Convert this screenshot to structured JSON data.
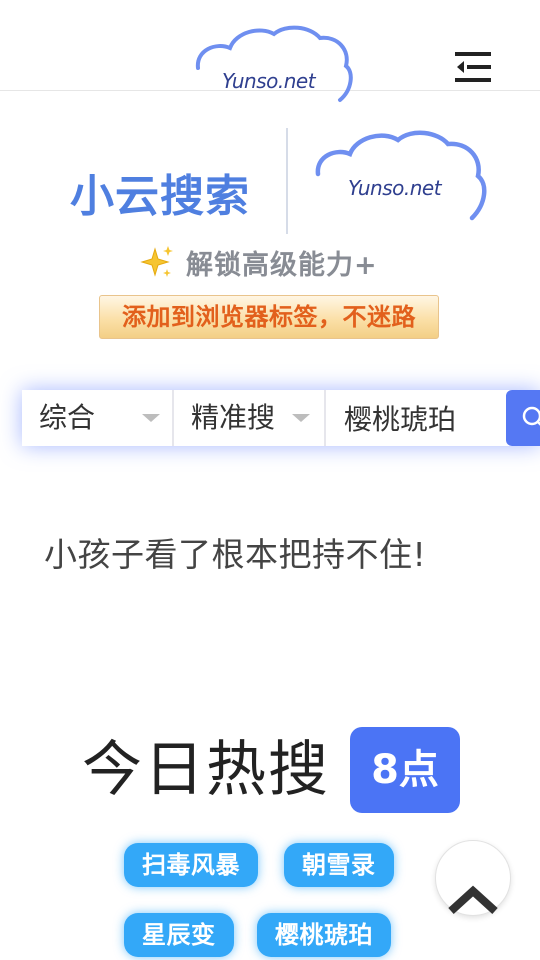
{
  "header": {
    "logo_text": "Yunso.net",
    "menu_icon": "menu-collapse-icon"
  },
  "brand": {
    "name": "小云搜索",
    "logo_text": "Yunso.net",
    "unlock_text": "解锁高级能力+",
    "unlock_icon": "sparkle-icon",
    "bookmark_text": "添加到浏览器标签，不迷路"
  },
  "search": {
    "category": "综合",
    "mode": "精准搜",
    "query": "樱桃琥珀",
    "button_icon": "search-icon"
  },
  "headline": "小孩子看了根本把持不住!",
  "hot": {
    "title": "今日热搜",
    "time": "8点",
    "tags": [
      "扫毒风暴",
      "朝雪录",
      "星辰变",
      "樱桃琥珀"
    ]
  },
  "back_to_top_icon": "chevron-up-icon",
  "colors": {
    "brand_blue": "#4f7fe0",
    "accent_blue": "#4b74f5",
    "tag_blue": "#33a8f8",
    "badge_orange": "#e2601c",
    "badge_gold": "#f3cf86"
  }
}
